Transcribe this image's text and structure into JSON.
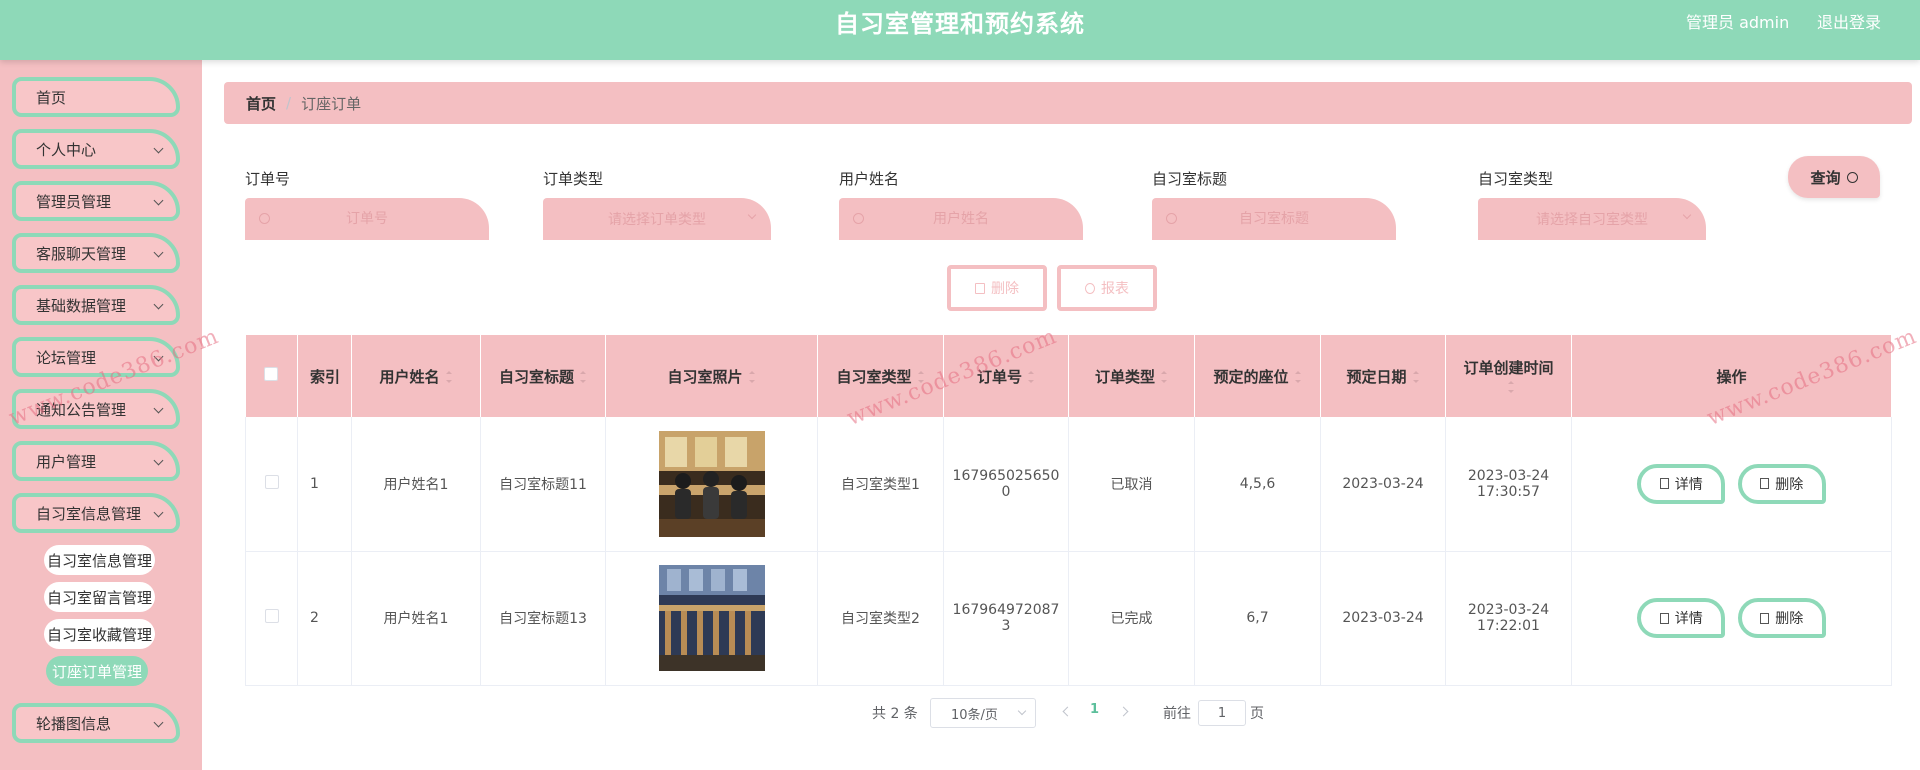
{
  "header": {
    "title": "自习室管理和预约系统",
    "admin": "管理员 admin",
    "logout": "退出登录"
  },
  "sidebar": {
    "items": [
      {
        "label": "首页"
      },
      {
        "label": "个人中心"
      },
      {
        "label": "管理员管理"
      },
      {
        "label": "客服聊天管理"
      },
      {
        "label": "基础数据管理"
      },
      {
        "label": "论坛管理"
      },
      {
        "label": "通知公告管理"
      },
      {
        "label": "用户管理"
      },
      {
        "label": "自习室信息管理"
      },
      {
        "label": "轮播图信息"
      }
    ],
    "subitems": [
      {
        "label": "自习室信息管理"
      },
      {
        "label": "自习室留言管理"
      },
      {
        "label": "自习室收藏管理"
      },
      {
        "label": "订座订单管理"
      }
    ]
  },
  "breadcrumb": {
    "home": "首页",
    "sep": "/",
    "current": "订座订单"
  },
  "filters": [
    {
      "label": "订单号",
      "placeholder": "订单号"
    },
    {
      "label": "订单类型",
      "placeholder": "请选择订单类型"
    },
    {
      "label": "用户姓名",
      "placeholder": "用户姓名"
    },
    {
      "label": "自习室标题",
      "placeholder": "自习室标题"
    },
    {
      "label": "自习室类型",
      "placeholder": "请选择自习室类型"
    }
  ],
  "query_label": "查询",
  "actions": {
    "delete": "删除",
    "report": "报表"
  },
  "table": {
    "headers": [
      "索引",
      "用户姓名",
      "自习室标题",
      "自习室照片",
      "自习室类型",
      "订单号",
      "订单类型",
      "预定的座位",
      "预定日期",
      "订单创建时间",
      "操作"
    ],
    "rows": [
      {
        "index": "1",
        "user": "用户姓名1",
        "title": "自习室标题11",
        "type": "自习室类型1",
        "order_no": "1679650256500",
        "order_type": "已取消",
        "seats": "4,5,6",
        "date": "2023-03-24",
        "created": "2023-03-24 17:30:57"
      },
      {
        "index": "2",
        "user": "用户姓名1",
        "title": "自习室标题13",
        "type": "自习室类型2",
        "order_no": "1679649720873",
        "order_type": "已完成",
        "seats": "6,7",
        "date": "2023-03-24",
        "created": "2023-03-24 17:22:01"
      }
    ],
    "row_actions": {
      "detail": "详情",
      "delete": "删除"
    }
  },
  "pagination": {
    "total": "共 2 条",
    "page_size": "10条/页",
    "current": "1",
    "goto": "前往",
    "page_input": "1",
    "page_unit": "页"
  },
  "watermark": "www.code386.com",
  "colors": {
    "mint": "#8ed9b8",
    "pink": "#f4bfc2",
    "pink_text": "#e5a3a8"
  }
}
